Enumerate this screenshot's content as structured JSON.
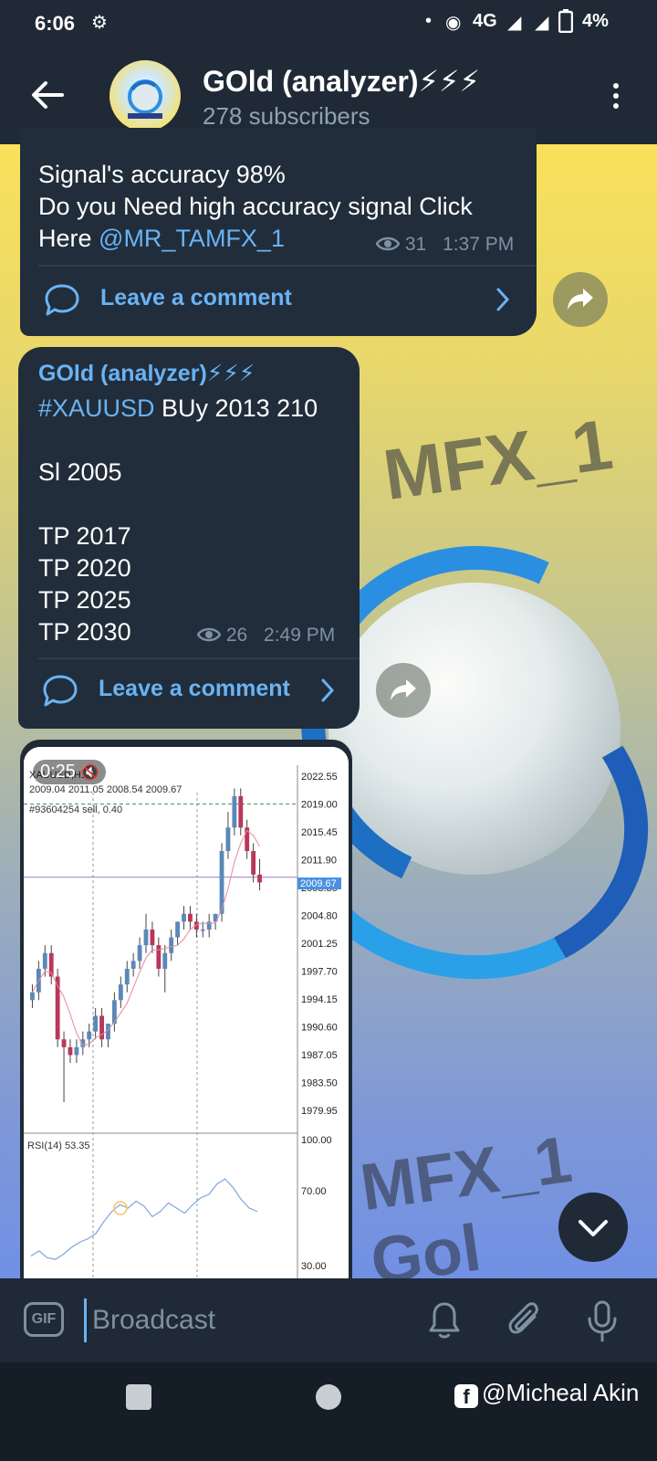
{
  "status_bar": {
    "time": "6:06",
    "network": "4G",
    "battery": "4%",
    "icons": [
      "settings-gear-icon",
      "dot-icon",
      "hotspot-icon",
      "signal-icon",
      "signal-icon",
      "battery-icon"
    ]
  },
  "header": {
    "title": "GOld (analyzer)⚡⚡⚡",
    "subtitle": "278 subscribers"
  },
  "messages": [
    {
      "lines": [
        "Signal's accuracy 98%",
        "Do you Need high accuracy signal Click",
        "Here "
      ],
      "mention": "@MR_TAMFX_1",
      "views": "31",
      "time": "1:37 PM",
      "comment_label": "Leave a comment"
    },
    {
      "sender": "GOld (analyzer)⚡⚡⚡",
      "hashtag": "#XAUUSD",
      "first_line_rest": " BUy 2013 210",
      "sl": "Sl 2005",
      "tps": [
        "TP 2017",
        "TP 2020",
        "TP 2025",
        "TP 2030"
      ],
      "views": "26",
      "time": "2:49 PM",
      "comment_label": "Leave a comment"
    }
  ],
  "media": {
    "duration": "0:25",
    "chart_header": "2009.04 2011.05 2008.54 2009.67",
    "chart_symbol": "XAUUSD,H1",
    "order_line": "#93604254 sell, 0.40",
    "current_price": "2009.67",
    "rsi_label": "RSI(14) 53.35",
    "rsi_ticks": [
      "100.00",
      "70.00",
      "30.00"
    ]
  },
  "chart_data": {
    "type": "candlestick",
    "title": "XAUUSD,H1",
    "price_ticks": [
      "2022.55",
      "2019.00",
      "2015.45",
      "2011.90",
      "2008.35",
      "2004.80",
      "2001.25",
      "1997.70",
      "1994.15",
      "1990.60",
      "1987.05",
      "1983.50",
      "1979.95"
    ],
    "ylim": [
      1979.95,
      2022.55
    ],
    "grid": true,
    "candles": [
      [
        1994,
        1996,
        1993,
        1995
      ],
      [
        1995,
        1999,
        1994,
        1998
      ],
      [
        1998,
        2001,
        1997,
        2000
      ],
      [
        2000,
        2001,
        1996,
        1997
      ],
      [
        1997,
        1998,
        1988,
        1989
      ],
      [
        1989,
        1990,
        1981,
        1988
      ],
      [
        1988,
        1989,
        1986,
        1987
      ],
      [
        1987,
        1989,
        1986,
        1988
      ],
      [
        1988,
        1990,
        1987,
        1989
      ],
      [
        1989,
        1991,
        1988,
        1990
      ],
      [
        1990,
        1993,
        1989,
        1992
      ],
      [
        1992,
        1993,
        1988,
        1989
      ],
      [
        1989,
        1991,
        1988,
        1991
      ],
      [
        1991,
        1995,
        1990,
        1994
      ],
      [
        1994,
        1997,
        1993,
        1996
      ],
      [
        1996,
        1999,
        1995,
        1998
      ],
      [
        1998,
        2000,
        1997,
        1999
      ],
      [
        1999,
        2002,
        1998,
        2001
      ],
      [
        2001,
        2005,
        2000,
        2003
      ],
      [
        2003,
        2004,
        2000,
        2001
      ],
      [
        2001,
        2002,
        1997,
        1998
      ],
      [
        1998,
        2001,
        1995,
        2000
      ],
      [
        2000,
        2003,
        1999,
        2002
      ],
      [
        2002,
        2004,
        2001,
        2004
      ],
      [
        2004,
        2006,
        2003,
        2005
      ],
      [
        2005,
        2006,
        2003,
        2004
      ],
      [
        2004,
        2005,
        2002,
        2003
      ],
      [
        2003,
        2004,
        2002,
        2003
      ],
      [
        2003,
        2005,
        2002,
        2004
      ],
      [
        2004,
        2005,
        2003,
        2005
      ],
      [
        2005,
        2014,
        2004,
        2013
      ],
      [
        2013,
        2018,
        2012,
        2016
      ],
      [
        2016,
        2021,
        2015,
        2020
      ],
      [
        2020,
        2021,
        2015,
        2016
      ],
      [
        2016,
        2017,
        2012,
        2013
      ],
      [
        2013,
        2014,
        2009,
        2010
      ],
      [
        2010,
        2012,
        2008,
        2009
      ]
    ],
    "rsi": [
      32,
      35,
      31,
      30,
      33,
      37,
      40,
      42,
      45,
      52,
      58,
      62,
      60,
      64,
      61,
      55,
      58,
      63,
      60,
      57,
      62,
      66,
      68,
      74,
      77,
      72,
      65,
      60,
      58
    ]
  },
  "input_bar": {
    "gif_label": "GIF",
    "placeholder": "Broadcast"
  },
  "wallpaper": {
    "text_1": "MFX_1",
    "text_2": "MFX_1 Gol"
  },
  "nav": {
    "watermark": "@Micheal Akin"
  },
  "colors": {
    "accent": "#6ab3f3",
    "bubble": "#212d3b",
    "header_bg": "#1f2a36"
  }
}
